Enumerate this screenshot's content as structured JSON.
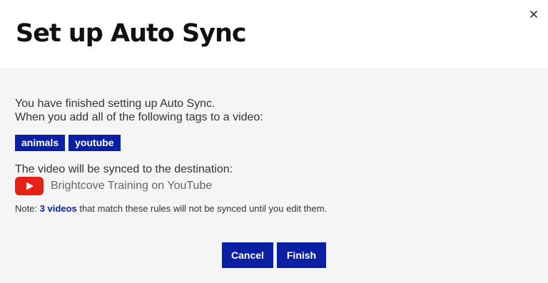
{
  "dialog": {
    "title": "Set up Auto Sync",
    "close_icon": "close-icon"
  },
  "content": {
    "intro_line1": "You have finished setting up Auto Sync.",
    "intro_line2": "When you add all of the following tags to a video:",
    "tags": [
      "animals",
      "youtube"
    ],
    "destination_label": "The video will be synced to the destination:",
    "destination_icon": "youtube-icon",
    "destination_name": "Brightcove Training on YouTube",
    "note_prefix": "Note: ",
    "note_link": "3 videos",
    "note_suffix": " that match these rules will not be synced until you edit them."
  },
  "actions": {
    "cancel_label": "Cancel",
    "finish_label": "Finish"
  },
  "colors": {
    "accent": "#0a1fa3",
    "youtube_red": "#e62117",
    "body_background": "#f5f5f5"
  }
}
